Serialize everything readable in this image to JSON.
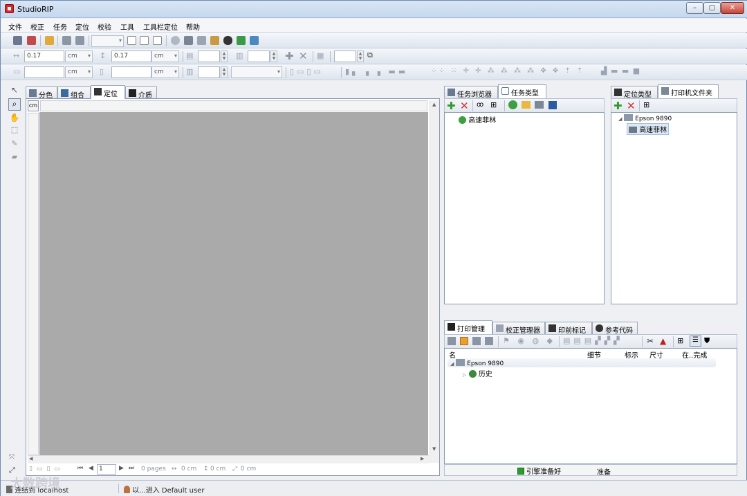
{
  "window": {
    "title": "StudioRIP",
    "btn_min": "–",
    "btn_max": "▢",
    "btn_close": "✕"
  },
  "menu": [
    "文件",
    "校正",
    "任务",
    "定位",
    "校验",
    "工具",
    "工具栏定位",
    "帮助"
  ],
  "toolbar2": {
    "width_value": "0.17",
    "width_unit": "cm",
    "height_value": "0.17",
    "height_unit": "cm"
  },
  "toolbar3": {
    "unit1": "cm",
    "unit2": "cm"
  },
  "left_tools": [
    "arrow-icon",
    "zoom-icon",
    "hand-icon",
    "crop-icon",
    "edit-icon",
    "stamp-icon"
  ],
  "canvas": {
    "tabs": [
      "分色",
      "组合",
      "定位",
      "介质"
    ],
    "active_tab": "定位",
    "ruler_unit": "cm",
    "bottom": {
      "page": "1",
      "pages": "0 pages",
      "w": "0 cm",
      "h": "0 cm",
      "diag": "0 cm"
    }
  },
  "task_panel": {
    "tabs": [
      "任务浏览器",
      "任务类型"
    ],
    "items": [
      "高速菲林"
    ]
  },
  "printer_panel": {
    "tabs": [
      "定位类型",
      "打印机文件夹"
    ],
    "printer": "Epson 9890",
    "child": "高速菲林"
  },
  "print_panel": {
    "tabs": [
      "打印管理",
      "校正管理器",
      "印前标记",
      "参考代码"
    ],
    "columns": [
      "名",
      "细节",
      "标示",
      "尺寸",
      "在..完成"
    ],
    "printer": "Epson 9890",
    "history": "历史",
    "status_ready": "引擎准备好",
    "status_state": "准备"
  },
  "statusbar": {
    "connection": "连结到 localhost",
    "user": "以...进入 Default user"
  },
  "watermark": "大数跨境",
  "colors": {
    "accent_green": "#2c9a2c",
    "accent_red": "#d03030",
    "canvas_gray": "#aaaaaa"
  }
}
